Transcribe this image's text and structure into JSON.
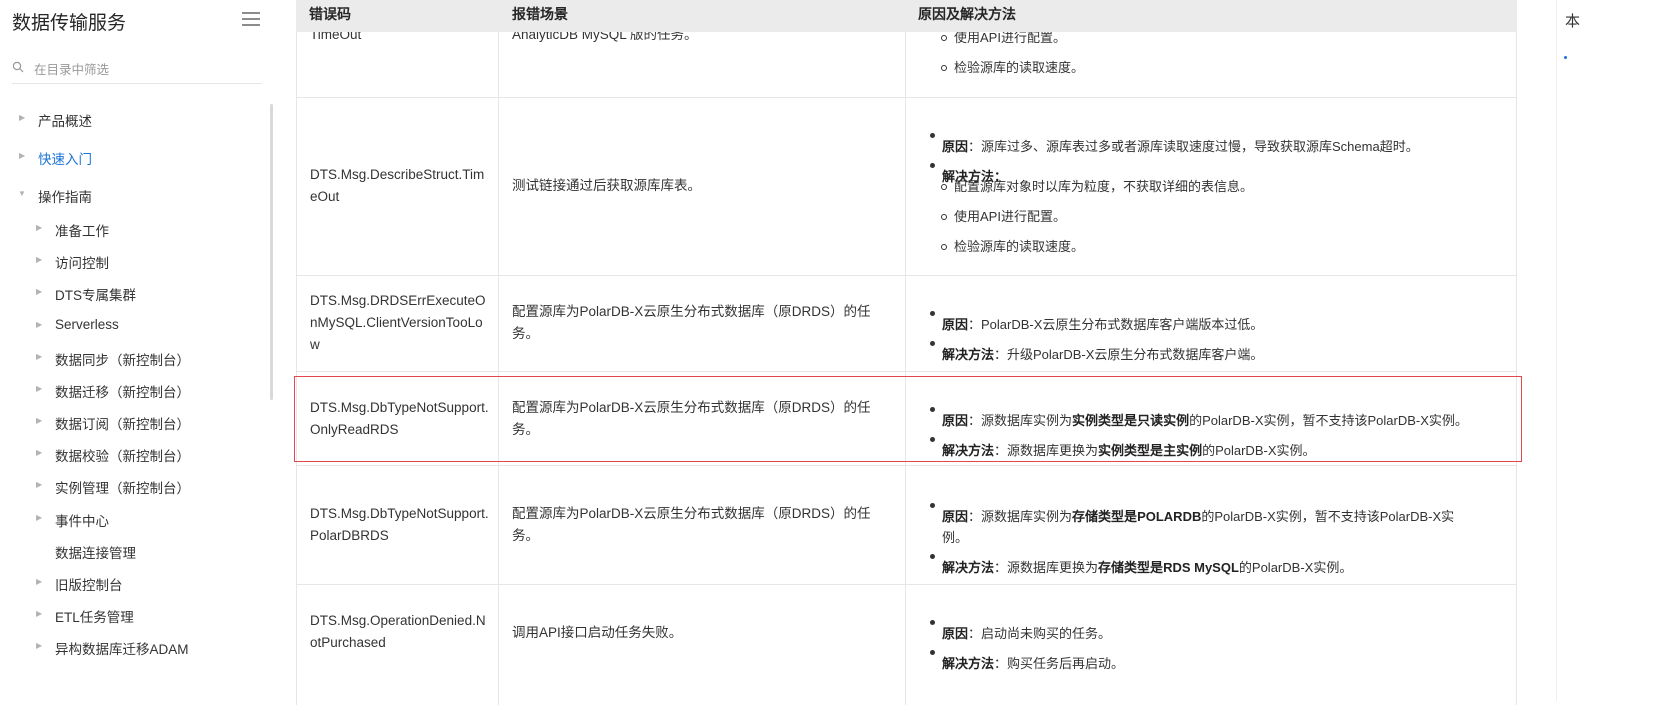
{
  "sidebar": {
    "title": "数据传输服务",
    "search_placeholder": "在目录中筛选",
    "items": [
      {
        "label": "产品概述"
      },
      {
        "label": "快速入门"
      },
      {
        "label": "操作指南"
      },
      {
        "label": "准备工作"
      },
      {
        "label": "访问控制"
      },
      {
        "label": "DTS专属集群"
      },
      {
        "label": "Serverless"
      },
      {
        "label": "数据同步（新控制台）"
      },
      {
        "label": "数据迁移（新控制台）"
      },
      {
        "label": "数据订阅（新控制台）"
      },
      {
        "label": "数据校验（新控制台）"
      },
      {
        "label": "实例管理（新控制台）"
      },
      {
        "label": "事件中心"
      },
      {
        "label": "数据连接管理"
      },
      {
        "label": "旧版控制台"
      },
      {
        "label": "ETL任务管理"
      },
      {
        "label": "异构数据库迁移ADAM"
      }
    ]
  },
  "table": {
    "headers": [
      "错误码",
      "报错场景",
      "原因及解决方法"
    ],
    "rows": [
      {
        "code": "TimeOut",
        "scene": "AnalyticDB MySQL 版的任务。",
        "subs": [
          "使用API进行配置。",
          "检验源库的读取速度。"
        ]
      },
      {
        "code": "DTS.Msg.DescribeStruct.TimeOut",
        "scene": "测试链接通过后获取源库库表。",
        "cause_label": "原因",
        "cause": "：源库过多、源库表过多或者源库读取速度过慢，导致获取源库Schema超时。",
        "solution_label": "解决方法",
        "solution_suffix": "：",
        "subs": [
          "配置源库对象时以库为粒度，不获取详细的表信息。",
          "使用API进行配置。",
          "检验源库的读取速度。"
        ]
      },
      {
        "code": "DTS.Msg.DRDSErrExecuteOnMySQL.ClientVersionTooLow",
        "scene": "配置源库为PolarDB-X云原生分布式数据库（原DRDS）的任务。",
        "cause_label": "原因",
        "cause": "：PolarDB-X云原生分布式数据库客户端版本过低。",
        "solution_label": "解决方法",
        "solution": "：升级PolarDB-X云原生分布式数据库客户端。"
      },
      {
        "code": "DTS.Msg.DbTypeNotSupport.OnlyReadRDS",
        "scene": "配置源库为PolarDB-X云原生分布式数据库（原DRDS）的任务。",
        "cause_label": "原因",
        "cause_pre": "：源数据库实例为",
        "cause_b1": "实例类型",
        "cause_mid": "是",
        "cause_b2": "只读实例",
        "cause_post": "的PolarDB-X实例，暂不支持该PolarDB-X实例。",
        "solution_label": "解决方法",
        "solution_pre": "：源数据库更换为",
        "solution_b1": "实例类型",
        "solution_mid": "是",
        "solution_b2": "主实例",
        "solution_post": "的PolarDB-X实例。"
      },
      {
        "code": "DTS.Msg.DbTypeNotSupport.PolarDBRDS",
        "scene": "配置源库为PolarDB-X云原生分布式数据库（原DRDS）的任务。",
        "cause_label": "原因",
        "cause_pre": "：源数据库实例为",
        "cause_b1": "存储类型",
        "cause_mid": "是",
        "cause_b2": "POLARDB",
        "cause_post": "的PolarDB-X实例，暂不支持该PolarDB-X实",
        "cause_post2": "例。",
        "solution_label": "解决方法",
        "solution_pre": "：源数据库更换为",
        "solution_b1": "存储类型",
        "solution_mid": "是",
        "solution_b2": "RDS MySQL",
        "solution_post": "的PolarDB-X实例。"
      },
      {
        "code": "DTS.Msg.OperationDenied.NotPurchased",
        "scene": "调用API接口启动任务失败。",
        "cause_label": "原因",
        "cause": "：启动尚未购买的任务。",
        "solution_label": "解决方法",
        "solution": "：购买任务后再启动。"
      }
    ]
  },
  "right_fragment": {
    "text": "本"
  },
  "colors": {
    "accent": "#1c73d6",
    "highlight": "#e0484e",
    "header_bg": "#ebebeb"
  }
}
